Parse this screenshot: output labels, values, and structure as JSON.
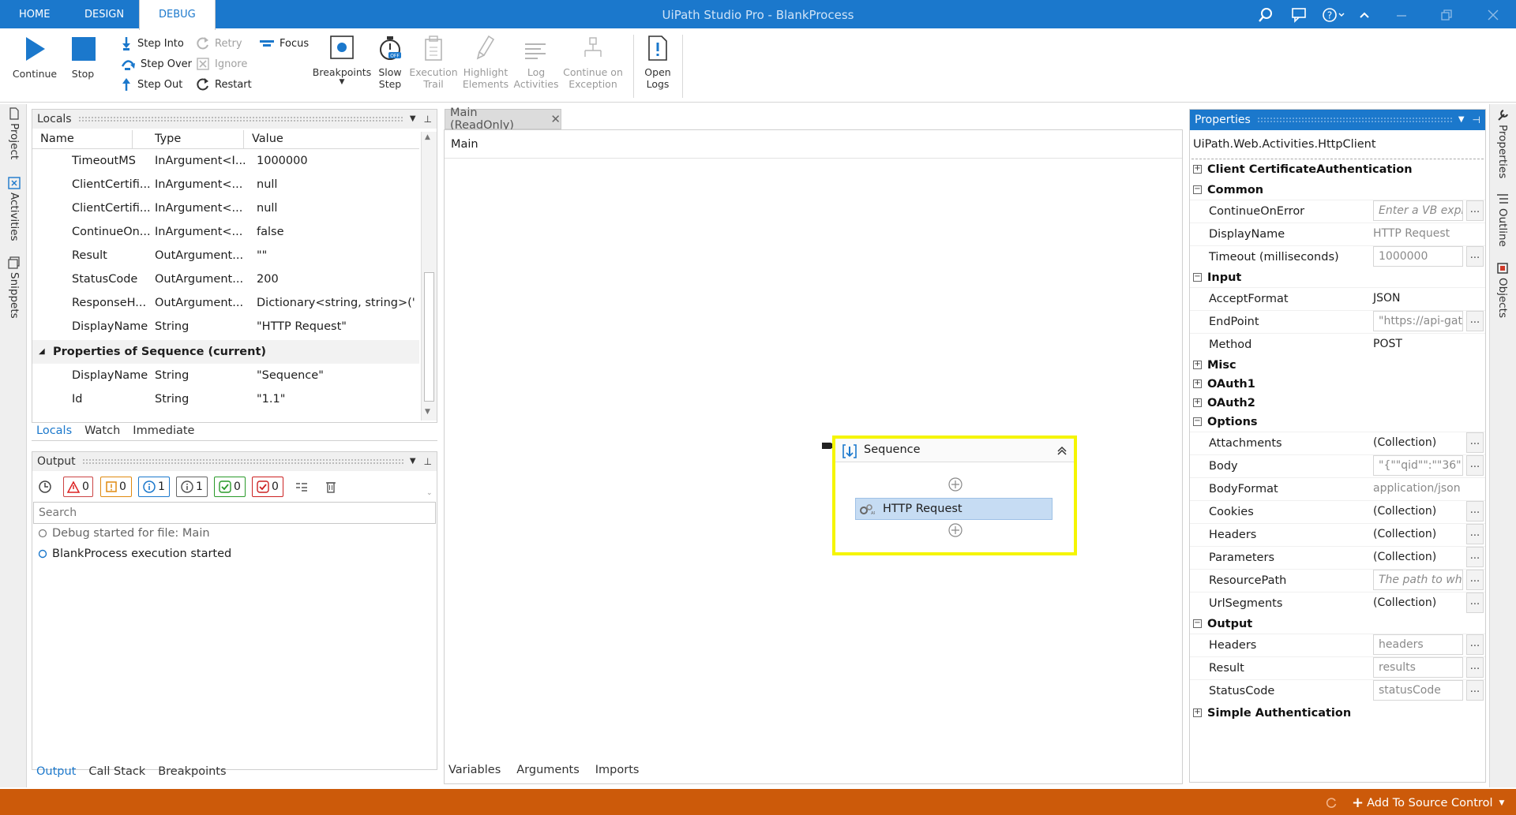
{
  "window": {
    "title": "UiPath Studio Pro - BlankProcess"
  },
  "tabs": [
    "HOME",
    "DESIGN",
    "DEBUG"
  ],
  "ribbon": {
    "continue": "Continue",
    "stop": "Stop",
    "step_into": "Step Into",
    "step_over": "Step Over",
    "step_out": "Step Out",
    "retry": "Retry",
    "ignore": "Ignore",
    "restart": "Restart",
    "focus": "Focus",
    "breakpoints": "Breakpoints",
    "slow_step_1": "Slow",
    "slow_step_2": "Step",
    "exec_trail_1": "Execution",
    "exec_trail_2": "Trail",
    "highlight_1": "Highlight",
    "highlight_2": "Elements",
    "log_1": "Log",
    "log_2": "Activities",
    "coe_1": "Continue on",
    "coe_2": "Exception",
    "open_logs_1": "Open",
    "open_logs_2": "Logs"
  },
  "side_left": [
    "Project",
    "Activities",
    "Snippets"
  ],
  "side_right": [
    "Properties",
    "Outline",
    "Objects"
  ],
  "locals": {
    "title": "Locals",
    "columns": [
      "Name",
      "Type",
      "Value"
    ],
    "rows": [
      {
        "name": "TimeoutMS",
        "type": "InArgument<I...",
        "value": "1000000"
      },
      {
        "name": "ClientCertifi...",
        "type": "InArgument<...",
        "value": "null"
      },
      {
        "name": "ClientCertifi...",
        "type": "InArgument<...",
        "value": "null"
      },
      {
        "name": "ContinueOn...",
        "type": "InArgument<...",
        "value": "false"
      },
      {
        "name": "Result",
        "type": "OutArgument...",
        "value": "\"\""
      },
      {
        "name": "StatusCode",
        "type": "OutArgument...",
        "value": "200"
      },
      {
        "name": "ResponseH...",
        "type": "OutArgument...",
        "value": "Dictionary<string, string>('"
      },
      {
        "name": "DisplayName",
        "type": "String",
        "value": "\"HTTP Request\""
      }
    ],
    "group": "Properties of Sequence (current)",
    "group_rows": [
      {
        "name": "DisplayName",
        "type": "String",
        "value": "\"Sequence\""
      },
      {
        "name": "Id",
        "type": "String",
        "value": "\"1.1\""
      }
    ],
    "bottom_tabs": [
      "Locals",
      "Watch",
      "Immediate"
    ]
  },
  "output": {
    "title": "Output",
    "filters": [
      "0",
      "0",
      "1",
      "1",
      "0",
      "0"
    ],
    "search_placeholder": "Search",
    "lines": [
      "Debug started for file: Main",
      "BlankProcess execution started"
    ],
    "bottom_tabs": [
      "Output",
      "Call Stack",
      "Breakpoints"
    ]
  },
  "designer": {
    "tab": "Main (ReadOnly)",
    "breadcrumb": "Main",
    "sequence_title": "Sequence",
    "activity": "HTTP Request",
    "bottom_tabs": [
      "Variables",
      "Arguments",
      "Imports"
    ]
  },
  "properties": {
    "title": "Properties",
    "class_name": "UiPath.Web.Activities.HttpClient",
    "sections": {
      "client_cert": "Client CertificateAuthentication",
      "common": "Common",
      "input": "Input",
      "misc": "Misc",
      "oauth1": "OAuth1",
      "oauth2": "OAuth2",
      "options": "Options",
      "output": "Output",
      "simple_auth": "Simple Authentication"
    },
    "common": [
      {
        "label": "ContinueOnError",
        "value": "Enter a VB expr"
      },
      {
        "label": "DisplayName",
        "value": "HTTP Request"
      },
      {
        "label": "Timeout (milliseconds)",
        "value": "1000000"
      }
    ],
    "input": [
      {
        "label": "AcceptFormat",
        "value": "JSON"
      },
      {
        "label": "EndPoint",
        "value": "\"https://api-gat"
      },
      {
        "label": "Method",
        "value": "POST"
      }
    ],
    "options": [
      {
        "label": "Attachments",
        "value": "(Collection)"
      },
      {
        "label": "Body",
        "value": "\"{\"\"qid\"\":\"\"36\"\","
      },
      {
        "label": "BodyFormat",
        "value": "application/json"
      },
      {
        "label": "Cookies",
        "value": "(Collection)"
      },
      {
        "label": "Headers",
        "value": "(Collection)"
      },
      {
        "label": "Parameters",
        "value": "(Collection)"
      },
      {
        "label": "ResourcePath",
        "value": "The path to whi"
      },
      {
        "label": "UrlSegments",
        "value": "(Collection)"
      }
    ],
    "output": [
      {
        "label": "Headers",
        "value": "headers"
      },
      {
        "label": "Result",
        "value": "results"
      },
      {
        "label": "StatusCode",
        "value": "statusCode"
      }
    ]
  },
  "statusbar": {
    "source_control": "Add To Source Control"
  },
  "colors": {
    "accent": "#1b78cc",
    "status": "#cc5a0a",
    "highlight": "#f5f500"
  }
}
